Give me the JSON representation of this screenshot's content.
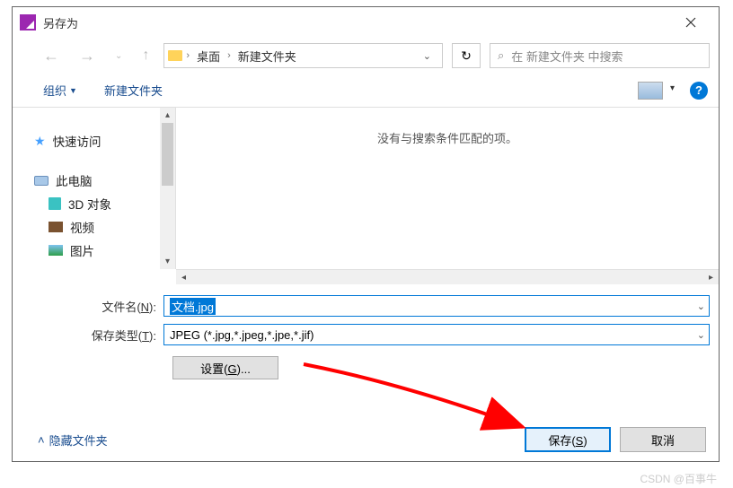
{
  "window": {
    "title": "另存为"
  },
  "breadcrumb": {
    "item1": "桌面",
    "item2": "新建文件夹"
  },
  "search": {
    "placeholder": "在 新建文件夹 中搜索"
  },
  "toolbar": {
    "organize": "组织",
    "newfolder": "新建文件夹"
  },
  "sidebar": {
    "quick": "快速访问",
    "thispc": "此电脑",
    "objects3d": "3D 对象",
    "videos": "视频",
    "pictures": "图片"
  },
  "content": {
    "empty": "没有与搜索条件匹配的项。"
  },
  "form": {
    "filename_label_pre": "文件名(",
    "filename_label_u": "N",
    "filename_label_post": "):",
    "filename_value": "文档.jpg",
    "type_label_pre": "保存类型(",
    "type_label_u": "T",
    "type_label_post": "):",
    "type_value": "JPEG (*.jpg,*.jpeg,*.jpe,*.jif)",
    "settings_pre": "设置(",
    "settings_u": "G",
    "settings_post": ")..."
  },
  "footer": {
    "hide": "隐藏文件夹",
    "save_pre": "保存(",
    "save_u": "S",
    "save_post": ")",
    "cancel": "取消"
  },
  "watermark": "CSDN @百事牛"
}
